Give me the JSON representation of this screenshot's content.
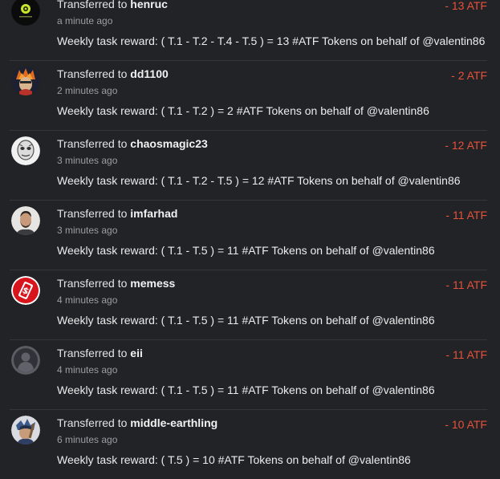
{
  "transfers": [
    {
      "prefix": "Transferred to",
      "user": "henruc",
      "time": "a minute ago",
      "memo": "Weekly task reward: ( T.1 - T.2 - T.4 - T.5 ) = 13 #ATF Tokens on behalf of @valentin86",
      "amount": "- 13 ATF",
      "avatar": "henruc-avatar"
    },
    {
      "prefix": "Transferred to",
      "user": "dd1100",
      "time": "2 minutes ago",
      "memo": "Weekly task reward: ( T.1 - T.2 ) = 2 #ATF Tokens on behalf of @valentin86",
      "amount": "- 2 ATF",
      "avatar": "dd1100-avatar"
    },
    {
      "prefix": "Transferred to",
      "user": "chaosmagic23",
      "time": "3 minutes ago",
      "memo": "Weekly task reward: ( T.1 - T.2 - T.5 ) = 12 #ATF Tokens on behalf of @valentin86",
      "amount": "- 12 ATF",
      "avatar": "chaosmagic23-avatar"
    },
    {
      "prefix": "Transferred to",
      "user": "imfarhad",
      "time": "3 minutes ago",
      "memo": "Weekly task reward: ( T.1 - T.5 ) = 11 #ATF Tokens on behalf of @valentin86",
      "amount": "- 11 ATF",
      "avatar": "imfarhad-avatar"
    },
    {
      "prefix": "Transferred to",
      "user": "memess",
      "time": "4 minutes ago",
      "memo": "Weekly task reward: ( T.1 - T.5 ) = 11 #ATF Tokens on behalf of @valentin86",
      "amount": "- 11 ATF",
      "avatar": "memess-avatar"
    },
    {
      "prefix": "Transferred to",
      "user": "eii",
      "time": "4 minutes ago",
      "memo": "Weekly task reward: ( T.1 - T.5 ) = 11 #ATF Tokens on behalf of @valentin86",
      "amount": "- 11 ATF",
      "avatar": "default-user-avatar"
    },
    {
      "prefix": "Transferred to",
      "user": "middle-earthling",
      "time": "6 minutes ago",
      "memo": "Weekly task reward: ( T.5 ) = 10 #ATF Tokens on behalf of @valentin86",
      "amount": "- 10 ATF",
      "avatar": "middle-earthling-avatar"
    }
  ],
  "colors": {
    "background": "#212327",
    "amount": "#e8513a",
    "divider": "#34363b",
    "muted": "#9b9ea4"
  }
}
